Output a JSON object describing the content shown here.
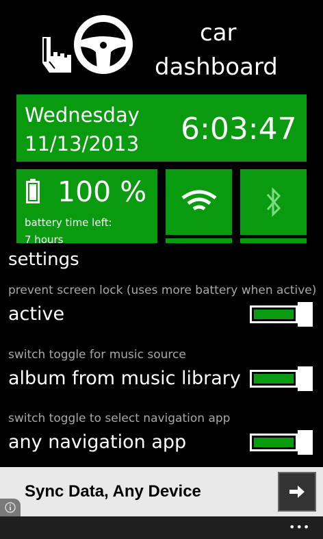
{
  "header": {
    "title_line1": "car",
    "title_line2": "dashboard",
    "logo_icon": "hand-steering-wheel-icon"
  },
  "tiles": {
    "day": "Wednesday",
    "date": "11/13/2013",
    "time": "6:03:47",
    "battery_icon": "battery-icon",
    "battery_percent": "100 %",
    "battery_label": "battery time left:",
    "battery_time": "7 hours",
    "wifi_icon": "wifi-icon",
    "bluetooth_icon": "bluetooth-icon",
    "tile_color": "#0a9a10"
  },
  "settings": {
    "heading": "settings",
    "items": [
      {
        "caption": "prevent screen lock (uses more battery when active)",
        "value": "active"
      },
      {
        "caption": "switch toggle for music source",
        "value": "album from music library"
      },
      {
        "caption": "switch toggle to select navigation app",
        "value": "any navigation app"
      }
    ]
  },
  "ad": {
    "text": "Sync Data, Any Device",
    "info_icon": "info-icon",
    "arrow_icon": "arrow-right-icon"
  },
  "appbar": {
    "more_label": "•••"
  }
}
